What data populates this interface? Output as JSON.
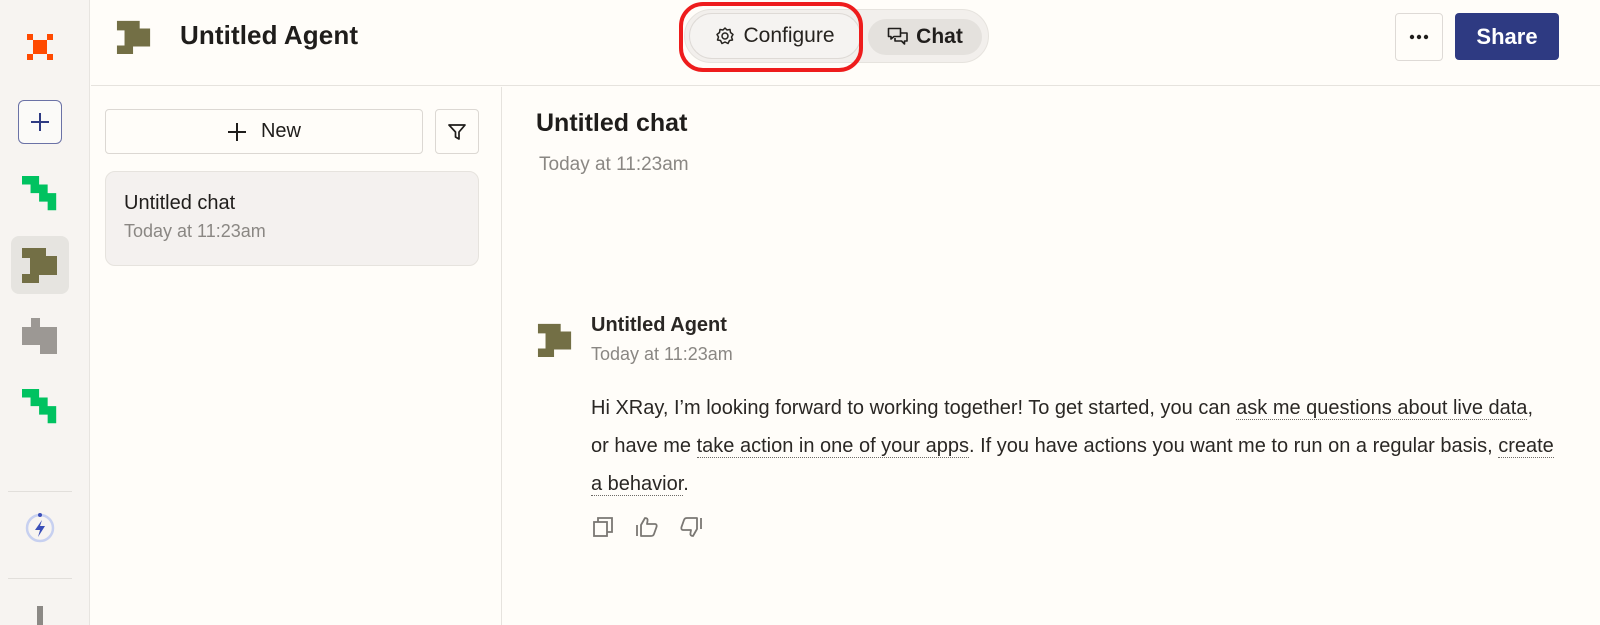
{
  "rail": {
    "items": [
      {
        "name": "brand-logo",
        "icon": "zapier-logo-icon",
        "color": "#ff4a00"
      },
      {
        "name": "add-agent",
        "icon": "plus-icon",
        "color": "#2e3a82"
      },
      {
        "name": "agent-green-1",
        "icon": "agent-green-icon",
        "color": "#00c260"
      },
      {
        "name": "agent-olive",
        "icon": "agent-olive-icon",
        "color": "#736f45",
        "active": true
      },
      {
        "name": "agent-gray",
        "icon": "agent-gray-icon",
        "color": "#9c9894"
      },
      {
        "name": "agent-green-2",
        "icon": "agent-green-icon",
        "color": "#00c260"
      },
      {
        "name": "activity",
        "icon": "lightning-icon",
        "color": "#3b4fb8"
      }
    ]
  },
  "header": {
    "title": "Untitled Agent",
    "mode_toggle": {
      "configure_label": "Configure",
      "chat_label": "Chat",
      "selected": "Chat"
    },
    "more_label": "•••",
    "share_label": "Share"
  },
  "list_panel": {
    "new_label": "New",
    "chats": [
      {
        "title": "Untitled chat",
        "time": "Today at 11:23am"
      }
    ]
  },
  "main": {
    "chat_title": "Untitled chat",
    "chat_time": "Today at 11:23am",
    "message": {
      "author": "Untitled Agent",
      "time": "Today at 11:23am",
      "parts": {
        "p1": "Hi XRay, I’m looking forward to working together! To get started, you can ",
        "link1": "ask me questions about live data",
        "p2": ", or have me ",
        "link2": "take action in one of your apps",
        "p3": ". If you have actions you want me to run on a regular basis, ",
        "link3": "create a behavior",
        "p4": "."
      },
      "actions": [
        "copy",
        "thumbs-up",
        "thumbs-down"
      ]
    }
  },
  "colors": {
    "brand_orange": "#ff4a00",
    "share_blue": "#2e3a82",
    "highlight_red": "#ee1c1c",
    "agent_olive": "#736f45",
    "agent_green": "#00c260"
  }
}
